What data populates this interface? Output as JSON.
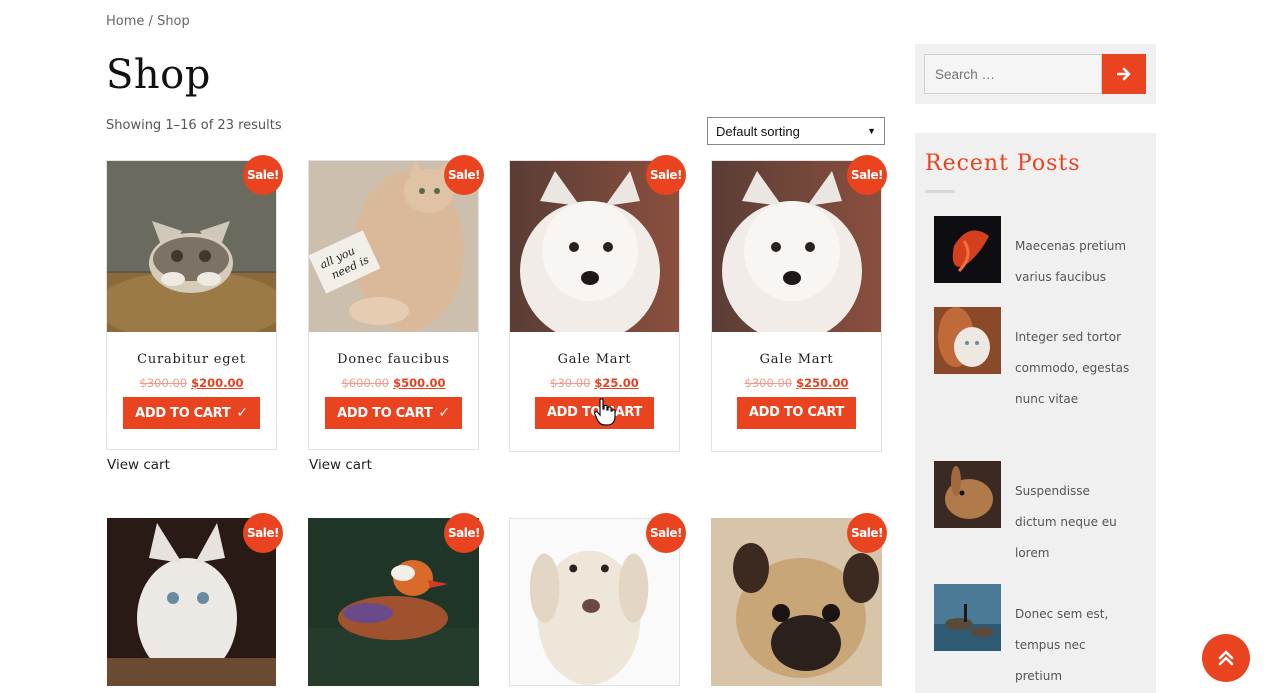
{
  "breadcrumb": {
    "home": "Home",
    "separator": "/",
    "current": "Shop"
  },
  "page": {
    "title": "Shop",
    "result_count": "Showing 1–16 of 23 results"
  },
  "sorting": {
    "selected": "Default sorting"
  },
  "sale_label": "Sale!",
  "view_cart_label": "View cart",
  "products": [
    {
      "name": "Curabitur eget",
      "old_price": "$300.00",
      "new_price": "$200.00",
      "button": "ADD TO CART",
      "added": true
    },
    {
      "name": "Donec faucibus",
      "old_price": "$600.00",
      "new_price": "$500.00",
      "button": "ADD TO CART",
      "added": true
    },
    {
      "name": "Gale Mart",
      "old_price": "$30.00",
      "new_price": "$25.00",
      "button": "ADD TO CART",
      "added": false
    },
    {
      "name": "Gale Mart",
      "old_price": "$300.00",
      "new_price": "$250.00",
      "button": "ADD TO CART",
      "added": false
    }
  ],
  "sidebar": {
    "search_placeholder": "Search …",
    "recent_posts_title": "Recent Posts",
    "posts": [
      {
        "title": "Maecenas pretium varius faucibus"
      },
      {
        "title": "Integer sed tortor commodo, egestas nunc vitae"
      },
      {
        "title": "Suspendisse dictum neque eu lorem"
      },
      {
        "title": "Donec sem est, tempus nec pretium"
      }
    ]
  },
  "colors": {
    "accent": "#e9431f",
    "sidebar_bg": "#f0f0f0"
  },
  "icons": {
    "search_button": "arrow-right-icon",
    "check": "check-icon",
    "scroll_top": "double-chevron-up-icon"
  }
}
